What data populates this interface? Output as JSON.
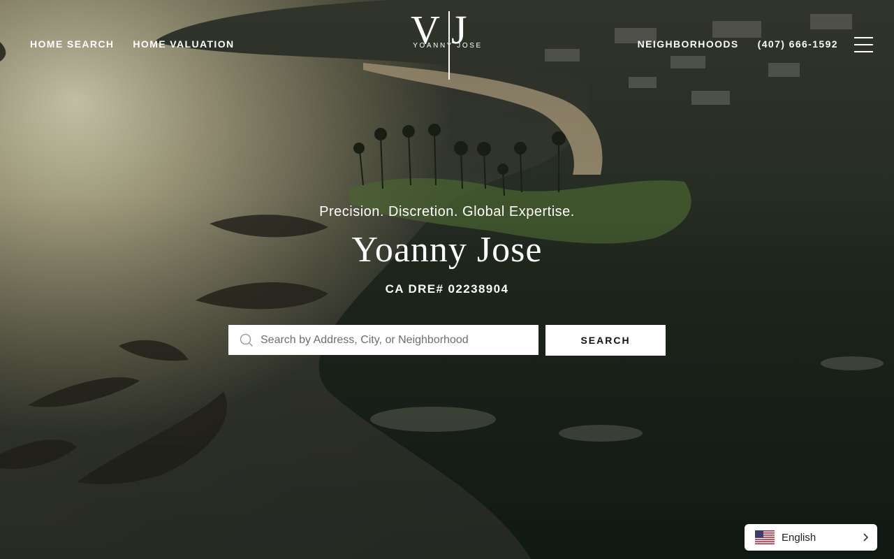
{
  "header": {
    "nav_left": [
      "HOME SEARCH",
      "HOME VALUATION"
    ],
    "nav_right": [
      "NEIGHBORHOODS",
      "(407) 666-1592"
    ],
    "menu_icon": "hamburger-menu-icon"
  },
  "logo": {
    "monogram_left": "V",
    "monogram_right": "J",
    "name": "YOANNY JOSE"
  },
  "hero": {
    "tagline": "Precision. Discretion. Global Expertise.",
    "agent_name": "Yoanny Jose",
    "license": "CA DRE# 02238904"
  },
  "search": {
    "placeholder": "Search by Address, City, or Neighborhood",
    "value": "",
    "button_label": "SEARCH",
    "icon": "search-icon"
  },
  "language": {
    "selected": "English",
    "flag_icon": "us-flag-icon",
    "chevron_icon": "chevron-right-icon"
  },
  "colors": {
    "text": "#ffffff",
    "search_bg": "#ffffff",
    "button_text": "#111111"
  }
}
